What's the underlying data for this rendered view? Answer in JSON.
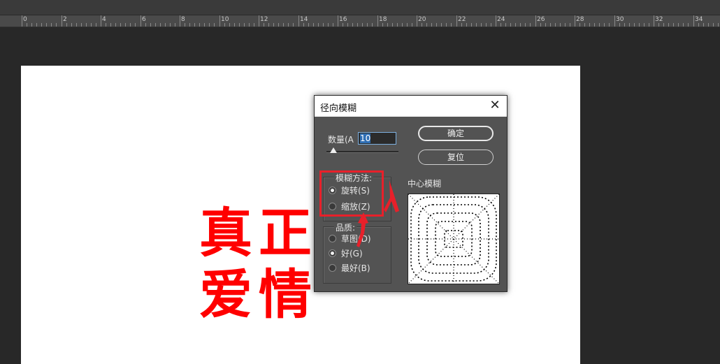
{
  "ruler": {
    "labels": [
      "0",
      "2",
      "4",
      "6",
      "8",
      "10",
      "12",
      "14",
      "16",
      "18",
      "20",
      "22",
      "24",
      "26",
      "28",
      "30",
      "32",
      "34"
    ]
  },
  "canvas_text": {
    "line1_a": "真",
    "line1_b": "正",
    "line2_a": "爱",
    "line2_b": "情",
    "color": "#ff0000"
  },
  "dialog": {
    "title": "径向模糊",
    "close_glyph": "✕",
    "amount_label": "数量(A",
    "amount_value": "10",
    "amount_slider_fraction": 0.1,
    "ok_label": "确定",
    "reset_label": "复位",
    "blur_method": {
      "legend": "模糊方法:",
      "options": [
        "旋转(S)",
        "缩放(Z)"
      ],
      "selected": "旋转(S)"
    },
    "quality": {
      "legend": "品质:",
      "options": [
        "草图(D)",
        "好(G)",
        "最好(B)"
      ],
      "selected": "好(G)"
    },
    "center_label": "中心模糊"
  },
  "annotation": {
    "highlight_color": "#e8202a"
  }
}
